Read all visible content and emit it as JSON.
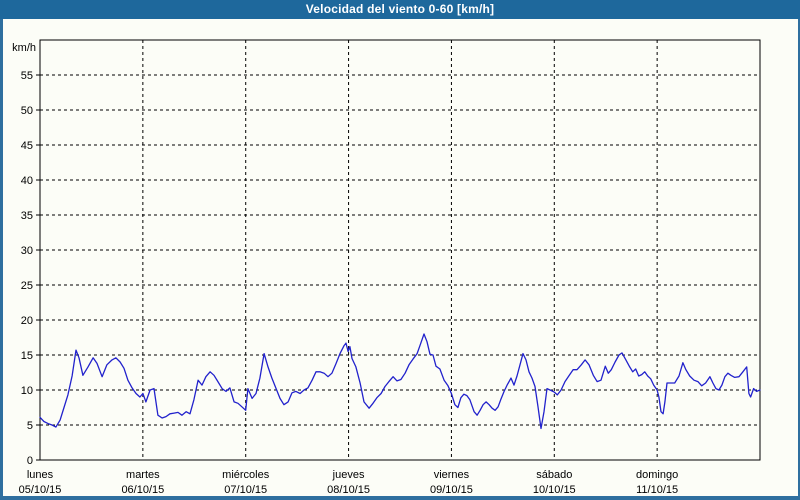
{
  "window": {
    "title": "Velocidad del viento 0-60 [km/h]"
  },
  "colors": {
    "titlebar_bg": "#1e689c",
    "titlebar_text": "#ffffff",
    "frame_border": "#2f6f9f",
    "plot_background": "#fcfdf7",
    "axis_and_grid": "#000000",
    "line": "#2222cc"
  },
  "chart_data": {
    "type": "line",
    "title": "Velocidad del viento 0-60 [km/h]",
    "ylabel": "km/h",
    "xlabel": "",
    "ylim": [
      0,
      60
    ],
    "yticks": [
      0,
      5,
      10,
      15,
      20,
      25,
      30,
      35,
      40,
      45,
      50,
      55
    ],
    "x_unit": "hours_from_start",
    "xlim": [
      0,
      168
    ],
    "grid": "dashed",
    "legend_position": "none",
    "x_day_ticks": [
      {
        "hour": 0,
        "day": "lunes",
        "date": "05/10/15"
      },
      {
        "hour": 24,
        "day": "martes",
        "date": "06/10/15"
      },
      {
        "hour": 48,
        "day": "miércoles",
        "date": "07/10/15"
      },
      {
        "hour": 72,
        "day": "jueves",
        "date": "08/10/15"
      },
      {
        "hour": 96,
        "day": "viernes",
        "date": "09/10/15"
      },
      {
        "hour": 120,
        "day": "sábado",
        "date": "10/10/15"
      },
      {
        "hour": 144,
        "day": "domingo",
        "date": "11/10/15"
      }
    ],
    "series": [
      {
        "name": "velocidad del viento",
        "color": "#2222cc",
        "points": [
          [
            0,
            6.1
          ],
          [
            0.9,
            5.5
          ],
          [
            1.9,
            5.2
          ],
          [
            2.8,
            5.0
          ],
          [
            3.7,
            4.7
          ],
          [
            4.7,
            5.7
          ],
          [
            5.6,
            7.5
          ],
          [
            6.5,
            9.3
          ],
          [
            7.5,
            12.0
          ],
          [
            8.4,
            15.7
          ],
          [
            9.1,
            14.6
          ],
          [
            10,
            12.1
          ],
          [
            11.2,
            13.3
          ],
          [
            12.4,
            14.6
          ],
          [
            13.3,
            13.8
          ],
          [
            14.5,
            11.9
          ],
          [
            15.6,
            13.6
          ],
          [
            16.8,
            14.3
          ],
          [
            17.7,
            14.6
          ],
          [
            18.7,
            14.0
          ],
          [
            19.6,
            13.1
          ],
          [
            20.5,
            11.4
          ],
          [
            21.5,
            10.3
          ],
          [
            22.4,
            9.5
          ],
          [
            23.3,
            9.0
          ],
          [
            24,
            9.5
          ],
          [
            24.7,
            8.3
          ],
          [
            25.7,
            10.0
          ],
          [
            26.6,
            10.2
          ],
          [
            27.5,
            6.4
          ],
          [
            28.5,
            6.0
          ],
          [
            29.4,
            6.2
          ],
          [
            30.3,
            6.6
          ],
          [
            31.3,
            6.7
          ],
          [
            32.2,
            6.8
          ],
          [
            33.1,
            6.4
          ],
          [
            34.1,
            6.9
          ],
          [
            35,
            6.6
          ],
          [
            35.9,
            8.6
          ],
          [
            36.9,
            11.4
          ],
          [
            37.8,
            10.7
          ],
          [
            38.7,
            11.9
          ],
          [
            39.7,
            12.6
          ],
          [
            40.6,
            12.1
          ],
          [
            41.5,
            11.2
          ],
          [
            42.5,
            10.2
          ],
          [
            43.4,
            9.8
          ],
          [
            44.3,
            10.3
          ],
          [
            45.3,
            8.3
          ],
          [
            46.2,
            8.1
          ],
          [
            47.1,
            7.6
          ],
          [
            48,
            7.1
          ],
          [
            48.5,
            10.2
          ],
          [
            49.5,
            8.8
          ],
          [
            50.4,
            9.5
          ],
          [
            51.3,
            11.7
          ],
          [
            52.3,
            15.2
          ],
          [
            53.2,
            13.3
          ],
          [
            54.1,
            11.7
          ],
          [
            55.1,
            10.2
          ],
          [
            56,
            8.8
          ],
          [
            56.9,
            7.9
          ],
          [
            57.9,
            8.3
          ],
          [
            58.8,
            9.6
          ],
          [
            59.7,
            9.8
          ],
          [
            60.7,
            9.5
          ],
          [
            61.6,
            10.0
          ],
          [
            62.5,
            10.3
          ],
          [
            63.5,
            11.4
          ],
          [
            64.4,
            12.6
          ],
          [
            65.3,
            12.6
          ],
          [
            66.3,
            12.4
          ],
          [
            67.2,
            11.9
          ],
          [
            68.1,
            12.4
          ],
          [
            69.1,
            13.8
          ],
          [
            70,
            15.2
          ],
          [
            70.9,
            16.3
          ],
          [
            71.4,
            16.7
          ],
          [
            71.9,
            15.5
          ],
          [
            72.3,
            16.2
          ],
          [
            72.8,
            14.5
          ],
          [
            73.7,
            13.3
          ],
          [
            74.7,
            11.0
          ],
          [
            75.6,
            8.3
          ],
          [
            76.8,
            7.4
          ],
          [
            77.7,
            8.1
          ],
          [
            78.6,
            8.9
          ],
          [
            79.6,
            9.5
          ],
          [
            80.5,
            10.5
          ],
          [
            81.4,
            11.2
          ],
          [
            82.4,
            11.9
          ],
          [
            83.3,
            11.3
          ],
          [
            84.2,
            11.5
          ],
          [
            85.2,
            12.4
          ],
          [
            86.1,
            13.6
          ],
          [
            87,
            14.4
          ],
          [
            88,
            15.2
          ],
          [
            88.7,
            16.4
          ],
          [
            89.6,
            18.0
          ],
          [
            90.3,
            16.9
          ],
          [
            91,
            15.1
          ],
          [
            91.7,
            15.0
          ],
          [
            92.4,
            13.4
          ],
          [
            93.3,
            13.0
          ],
          [
            94.3,
            11.4
          ],
          [
            95.2,
            10.6
          ],
          [
            96,
            9.5
          ],
          [
            96.8,
            7.9
          ],
          [
            97.5,
            7.5
          ],
          [
            98.2,
            8.9
          ],
          [
            98.9,
            9.4
          ],
          [
            99.6,
            9.2
          ],
          [
            100.3,
            8.6
          ],
          [
            101.3,
            6.9
          ],
          [
            102,
            6.4
          ],
          [
            102.7,
            7.1
          ],
          [
            103.4,
            7.9
          ],
          [
            104.1,
            8.3
          ],
          [
            104.8,
            7.9
          ],
          [
            105.5,
            7.4
          ],
          [
            106.2,
            7.1
          ],
          [
            106.9,
            7.6
          ],
          [
            107.5,
            8.6
          ],
          [
            108.3,
            9.8
          ],
          [
            109,
            10.7
          ],
          [
            109.9,
            11.7
          ],
          [
            110.6,
            10.7
          ],
          [
            111.3,
            12.0
          ],
          [
            112,
            13.6
          ],
          [
            112.7,
            15.2
          ],
          [
            113.4,
            14.3
          ],
          [
            114.1,
            12.6
          ],
          [
            114.8,
            11.7
          ],
          [
            115.5,
            10.5
          ],
          [
            116.2,
            7.6
          ],
          [
            116.9,
            4.5
          ],
          [
            117.6,
            6.9
          ],
          [
            118.3,
            10.2
          ],
          [
            119,
            10.0
          ],
          [
            120,
            9.7
          ],
          [
            120.7,
            9.3
          ],
          [
            121.6,
            10.0
          ],
          [
            122.5,
            11.2
          ],
          [
            123.5,
            12.1
          ],
          [
            124.4,
            12.9
          ],
          [
            125.3,
            12.9
          ],
          [
            126.3,
            13.6
          ],
          [
            127.2,
            14.3
          ],
          [
            128.1,
            13.6
          ],
          [
            129.1,
            12.1
          ],
          [
            130,
            11.2
          ],
          [
            130.9,
            11.4
          ],
          [
            131.9,
            13.4
          ],
          [
            132.6,
            12.4
          ],
          [
            133.3,
            12.9
          ],
          [
            134.2,
            14.0
          ],
          [
            135.1,
            15.0
          ],
          [
            135.8,
            15.3
          ],
          [
            136.7,
            14.3
          ],
          [
            137.6,
            13.3
          ],
          [
            138.3,
            12.6
          ],
          [
            139,
            13.0
          ],
          [
            139.7,
            12.0
          ],
          [
            140.4,
            12.2
          ],
          [
            141.1,
            12.6
          ],
          [
            141.8,
            12.0
          ],
          [
            142.5,
            11.6
          ],
          [
            143.2,
            10.7
          ],
          [
            144,
            10.0
          ],
          [
            144.4,
            9.0
          ],
          [
            144.9,
            6.9
          ],
          [
            145.4,
            6.6
          ],
          [
            145.8,
            8.3
          ],
          [
            146.3,
            11.0
          ],
          [
            147.2,
            11.0
          ],
          [
            148.1,
            11.0
          ],
          [
            149.1,
            12.0
          ],
          [
            150,
            13.9
          ],
          [
            150.7,
            12.9
          ],
          [
            151.6,
            12.0
          ],
          [
            152.6,
            11.4
          ],
          [
            153.5,
            11.2
          ],
          [
            154.4,
            10.6
          ],
          [
            155.3,
            11.0
          ],
          [
            156.3,
            11.9
          ],
          [
            157,
            11.0
          ],
          [
            157.7,
            10.2
          ],
          [
            158.4,
            10.0
          ],
          [
            159.1,
            10.7
          ],
          [
            159.8,
            11.9
          ],
          [
            160.5,
            12.4
          ],
          [
            161.2,
            12.1
          ],
          [
            162.1,
            11.8
          ],
          [
            163.1,
            11.9
          ],
          [
            164,
            12.6
          ],
          [
            164.9,
            13.3
          ],
          [
            165.4,
            9.5
          ],
          [
            165.8,
            9.0
          ],
          [
            166.5,
            10.2
          ],
          [
            167.2,
            9.8
          ],
          [
            168,
            10.0
          ]
        ]
      }
    ]
  }
}
